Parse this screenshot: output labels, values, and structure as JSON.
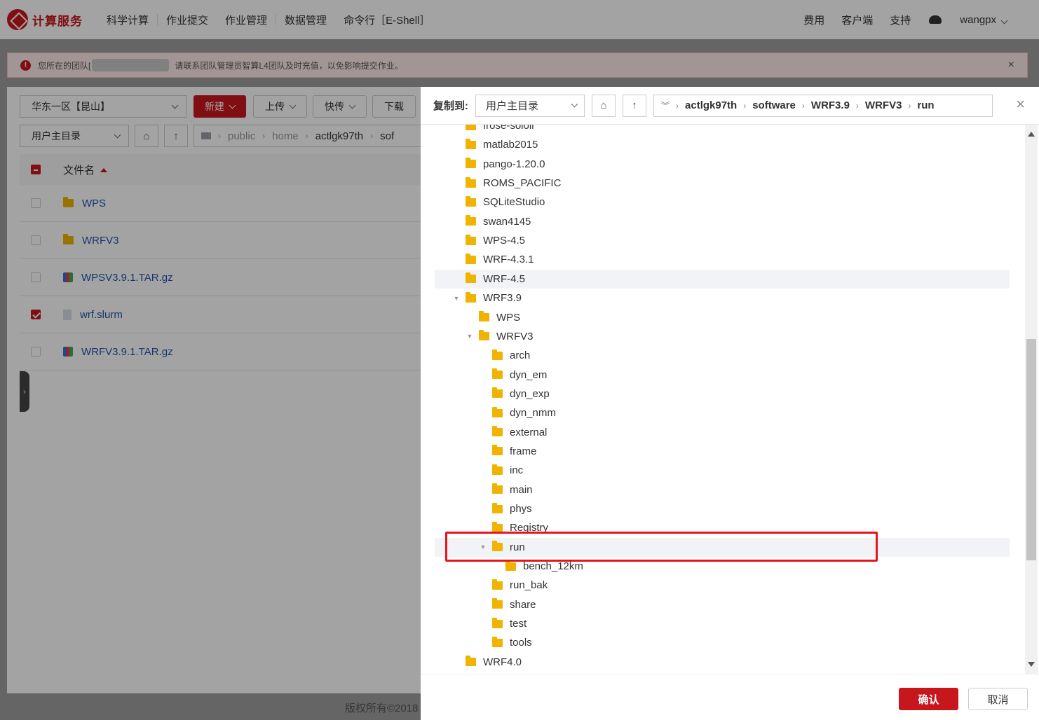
{
  "nav": {
    "logo": "计算服务",
    "items": [
      "科学计算",
      "作业提交",
      "作业管理",
      "数据管理",
      "命令行［E-Shell］"
    ],
    "right": [
      "费用",
      "客户端",
      "支持"
    ],
    "user": "wangpx"
  },
  "warning": {
    "prefix": "您所在的团队[",
    "text": "请联系团队管理员智算L4团队及时充值，以免影响提交作业。",
    "close": "×"
  },
  "left": {
    "region": "华东一区【昆山】",
    "new_label": "新建",
    "upload_label": "上传",
    "fast_label": "快传",
    "download_label": "下载",
    "dir_select": "用户主目录",
    "breadcrumb": [
      "public",
      "home",
      "actlgk97th",
      "sof"
    ],
    "col_name": "文件名",
    "col_extra": "",
    "files": [
      {
        "name": "WPS",
        "type": "folder",
        "checked": false
      },
      {
        "name": "WRFV3",
        "type": "folder",
        "checked": false
      },
      {
        "name": "WPSV3.9.1.TAR.gz",
        "type": "archive",
        "checked": false
      },
      {
        "name": "wrf.slurm",
        "type": "file",
        "checked": true
      },
      {
        "name": "WRFV3.9.1.TAR.gz",
        "type": "archive",
        "checked": false
      }
    ],
    "copyright": "版权所有©2018"
  },
  "dialog": {
    "label": "复制到:",
    "dir_select": "用户主目录",
    "breadcrumb": [
      "actlgk97th",
      "software",
      "WRF3.9",
      "WRFV3",
      "run"
    ],
    "close": "×",
    "tree": [
      {
        "name": "frose-soloil",
        "depth": 0,
        "caret": ""
      },
      {
        "name": "matlab2015",
        "depth": 0,
        "caret": ""
      },
      {
        "name": "pango-1.20.0",
        "depth": 0,
        "caret": ""
      },
      {
        "name": "ROMS_PACIFIC",
        "depth": 0,
        "caret": ""
      },
      {
        "name": "SQLiteStudio",
        "depth": 0,
        "caret": ""
      },
      {
        "name": "swan4145",
        "depth": 0,
        "caret": ""
      },
      {
        "name": "WPS-4.5",
        "depth": 0,
        "caret": ""
      },
      {
        "name": "WRF-4.3.1",
        "depth": 0,
        "caret": ""
      },
      {
        "name": "WRF-4.5",
        "depth": 0,
        "caret": "",
        "hl": true
      },
      {
        "name": "WRF3.9",
        "depth": 0,
        "caret": "▼"
      },
      {
        "name": "WPS",
        "depth": 1,
        "caret": ""
      },
      {
        "name": "WRFV3",
        "depth": 1,
        "caret": "▼"
      },
      {
        "name": "arch",
        "depth": 2,
        "caret": ""
      },
      {
        "name": "dyn_em",
        "depth": 2,
        "caret": ""
      },
      {
        "name": "dyn_exp",
        "depth": 2,
        "caret": ""
      },
      {
        "name": "dyn_nmm",
        "depth": 2,
        "caret": ""
      },
      {
        "name": "external",
        "depth": 2,
        "caret": ""
      },
      {
        "name": "frame",
        "depth": 2,
        "caret": ""
      },
      {
        "name": "inc",
        "depth": 2,
        "caret": ""
      },
      {
        "name": "main",
        "depth": 2,
        "caret": ""
      },
      {
        "name": "phys",
        "depth": 2,
        "caret": ""
      },
      {
        "name": "Registry",
        "depth": 2,
        "caret": ""
      },
      {
        "name": "run",
        "depth": 2,
        "caret": "▼",
        "hl": true,
        "selected": true
      },
      {
        "name": "bench_12km",
        "depth": 3,
        "caret": ""
      },
      {
        "name": "run_bak",
        "depth": 2,
        "caret": ""
      },
      {
        "name": "share",
        "depth": 2,
        "caret": ""
      },
      {
        "name": "test",
        "depth": 2,
        "caret": ""
      },
      {
        "name": "tools",
        "depth": 2,
        "caret": ""
      },
      {
        "name": "WRF4.0",
        "depth": 0,
        "caret": ""
      }
    ],
    "confirm_label": "确认",
    "cancel_label": "取消"
  },
  "colors": {
    "brand": "#c8161d",
    "highlight_box": "#e8141d",
    "folder": "#f0b400",
    "link": "#2255aa"
  }
}
